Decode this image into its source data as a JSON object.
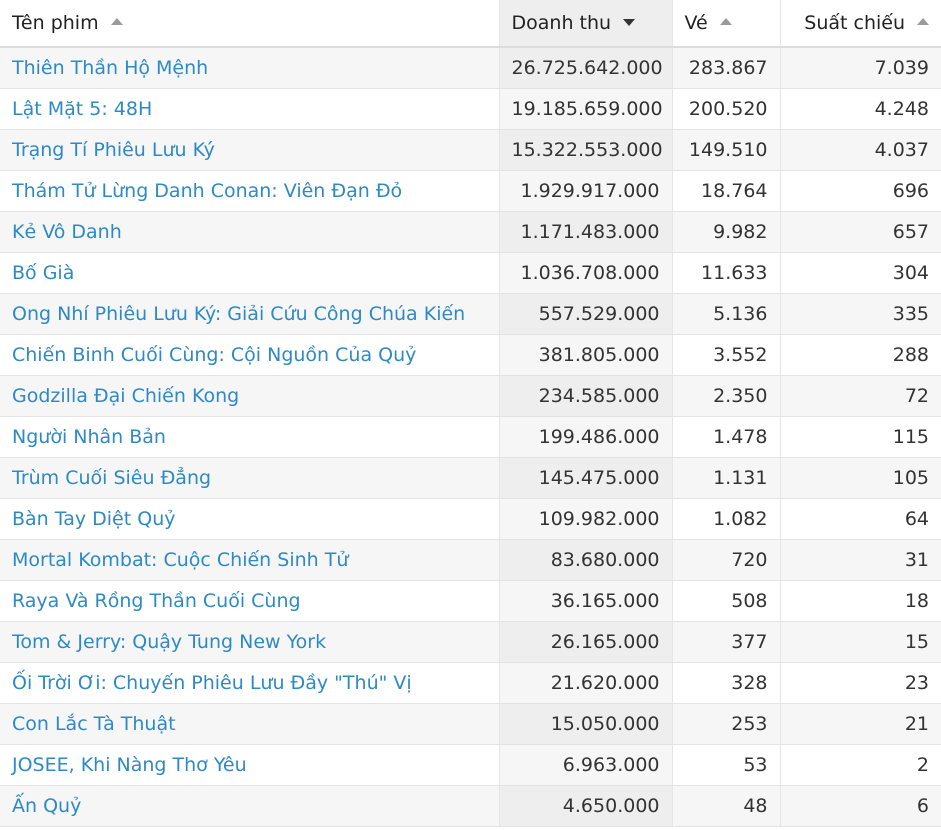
{
  "table": {
    "headers": {
      "title": "Tên phim",
      "revenue": "Doanh thu",
      "tickets": "Vé",
      "showtimes": "Suất chiếu"
    },
    "rows": [
      {
        "title": "Thiên Thần Hộ Mệnh",
        "revenue": "26.725.642.000",
        "tickets": "283.867",
        "showtimes": "7.039"
      },
      {
        "title": "Lật Mặt 5: 48H",
        "revenue": "19.185.659.000",
        "tickets": "200.520",
        "showtimes": "4.248"
      },
      {
        "title": "Trạng Tí Phiêu Lưu Ký",
        "revenue": "15.322.553.000",
        "tickets": "149.510",
        "showtimes": "4.037"
      },
      {
        "title": "Thám Tử Lừng Danh Conan: Viên Đạn Đỏ",
        "revenue": "1.929.917.000",
        "tickets": "18.764",
        "showtimes": "696"
      },
      {
        "title": "Kẻ Vô Danh",
        "revenue": "1.171.483.000",
        "tickets": "9.982",
        "showtimes": "657"
      },
      {
        "title": "Bố Già",
        "revenue": "1.036.708.000",
        "tickets": "11.633",
        "showtimes": "304"
      },
      {
        "title": "Ong Nhí Phiêu Lưu Ký: Giải Cứu Công Chúa Kiến",
        "revenue": "557.529.000",
        "tickets": "5.136",
        "showtimes": "335"
      },
      {
        "title": "Chiến Binh Cuối Cùng: Cội Nguồn Của Quỷ",
        "revenue": "381.805.000",
        "tickets": "3.552",
        "showtimes": "288"
      },
      {
        "title": "Godzilla Đại Chiến Kong",
        "revenue": "234.585.000",
        "tickets": "2.350",
        "showtimes": "72"
      },
      {
        "title": "Người Nhân Bản",
        "revenue": "199.486.000",
        "tickets": "1.478",
        "showtimes": "115"
      },
      {
        "title": "Trùm Cuối Siêu Đẳng",
        "revenue": "145.475.000",
        "tickets": "1.131",
        "showtimes": "105"
      },
      {
        "title": "Bàn Tay Diệt Quỷ",
        "revenue": "109.982.000",
        "tickets": "1.082",
        "showtimes": "64"
      },
      {
        "title": "Mortal Kombat: Cuộc Chiến Sinh Tử",
        "revenue": "83.680.000",
        "tickets": "720",
        "showtimes": "31"
      },
      {
        "title": "Raya Và Rồng Thần Cuối Cùng",
        "revenue": "36.165.000",
        "tickets": "508",
        "showtimes": "18"
      },
      {
        "title": "Tom & Jerry: Quậy Tung New York",
        "revenue": "26.165.000",
        "tickets": "377",
        "showtimes": "15"
      },
      {
        "title": "Ối Trời Ơi: Chuyến Phiêu Lưu Đầy \"Thú\" Vị",
        "revenue": "21.620.000",
        "tickets": "328",
        "showtimes": "23"
      },
      {
        "title": "Con Lắc Tà Thuật",
        "revenue": "15.050.000",
        "tickets": "253",
        "showtimes": "21"
      },
      {
        "title": "JOSEE, Khi Nàng Thơ Yêu",
        "revenue": "6.963.000",
        "tickets": "53",
        "showtimes": "2"
      },
      {
        "title": "Ấn Quỷ",
        "revenue": "4.650.000",
        "tickets": "48",
        "showtimes": "6"
      }
    ]
  },
  "icons": {
    "sort_asc": "triangle-up",
    "sort_desc": "triangle-down"
  },
  "colors": {
    "link": "#2d8ac6",
    "sorted_column_bg": "#eeeeee",
    "stripe_bg": "#f6f6f6"
  }
}
